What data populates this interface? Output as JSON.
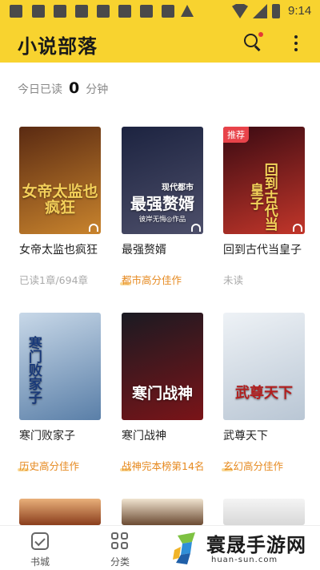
{
  "status_bar": {
    "time": "9:14"
  },
  "app_bar": {
    "title": "小说部落"
  },
  "reading": {
    "prefix": "今日已读",
    "minutes": "0",
    "suffix": "分钟"
  },
  "books": [
    {
      "cover_text": "女帝太监也疯狂",
      "name": "女帝太监也疯狂",
      "meta": "已读1章/694章",
      "meta_style": "progress",
      "colors": [
        "#5a2a12",
        "#c9842d"
      ],
      "text_color": "#f4d05a"
    },
    {
      "cover_text": "最强赘婿",
      "cover_sub": "现代都市",
      "cover_author": "彼岸无悔◎作品",
      "name": "最强赘婿",
      "meta": "都市高分佳作",
      "meta_style": "tag",
      "colors": [
        "#1c2340",
        "#4d4f6a"
      ],
      "text_color": "#ffffff"
    },
    {
      "cover_text": "回到古代当皇子",
      "badge": "推荐",
      "name": "回到古代当皇子",
      "meta": "未读",
      "meta_style": "progress",
      "colors": [
        "#3a0a12",
        "#c2362a"
      ],
      "text_color": "#f3d35a"
    },
    {
      "cover_text": "寒门败家子",
      "name": "寒门败家子",
      "meta": "历史高分佳作",
      "meta_style": "tag",
      "colors": [
        "#c8d8e8",
        "#5a7fa8"
      ],
      "text_color": "#1a3a7a"
    },
    {
      "cover_text": "寒门战神",
      "name": "寒门战神",
      "meta": "战神完本榜第14名",
      "meta_style": "tag",
      "colors": [
        "#1a1a22",
        "#7a1418"
      ],
      "text_color": "#ffffff"
    },
    {
      "cover_text": "武尊天下",
      "name": "武尊天下",
      "meta": "玄幻高分佳作",
      "meta_style": "tag",
      "colors": [
        "#eef2f6",
        "#b9c6d4"
      ],
      "text_color": "#b21f1f"
    }
  ],
  "partial_covers": [
    {
      "colors": [
        "#e9b07a",
        "#8a3d1c"
      ]
    },
    {
      "colors": [
        "#f0e4d0",
        "#6b4a32"
      ]
    },
    {
      "colors": [
        "#f4f4f4",
        "#d8d8d8"
      ]
    }
  ],
  "bottom_nav": [
    {
      "label": "书城",
      "icon": "bookstore-icon"
    },
    {
      "label": "分类",
      "icon": "category-grid-icon"
    }
  ],
  "watermark": {
    "text": "寰晟手游网",
    "url": "huan-sun.com"
  }
}
